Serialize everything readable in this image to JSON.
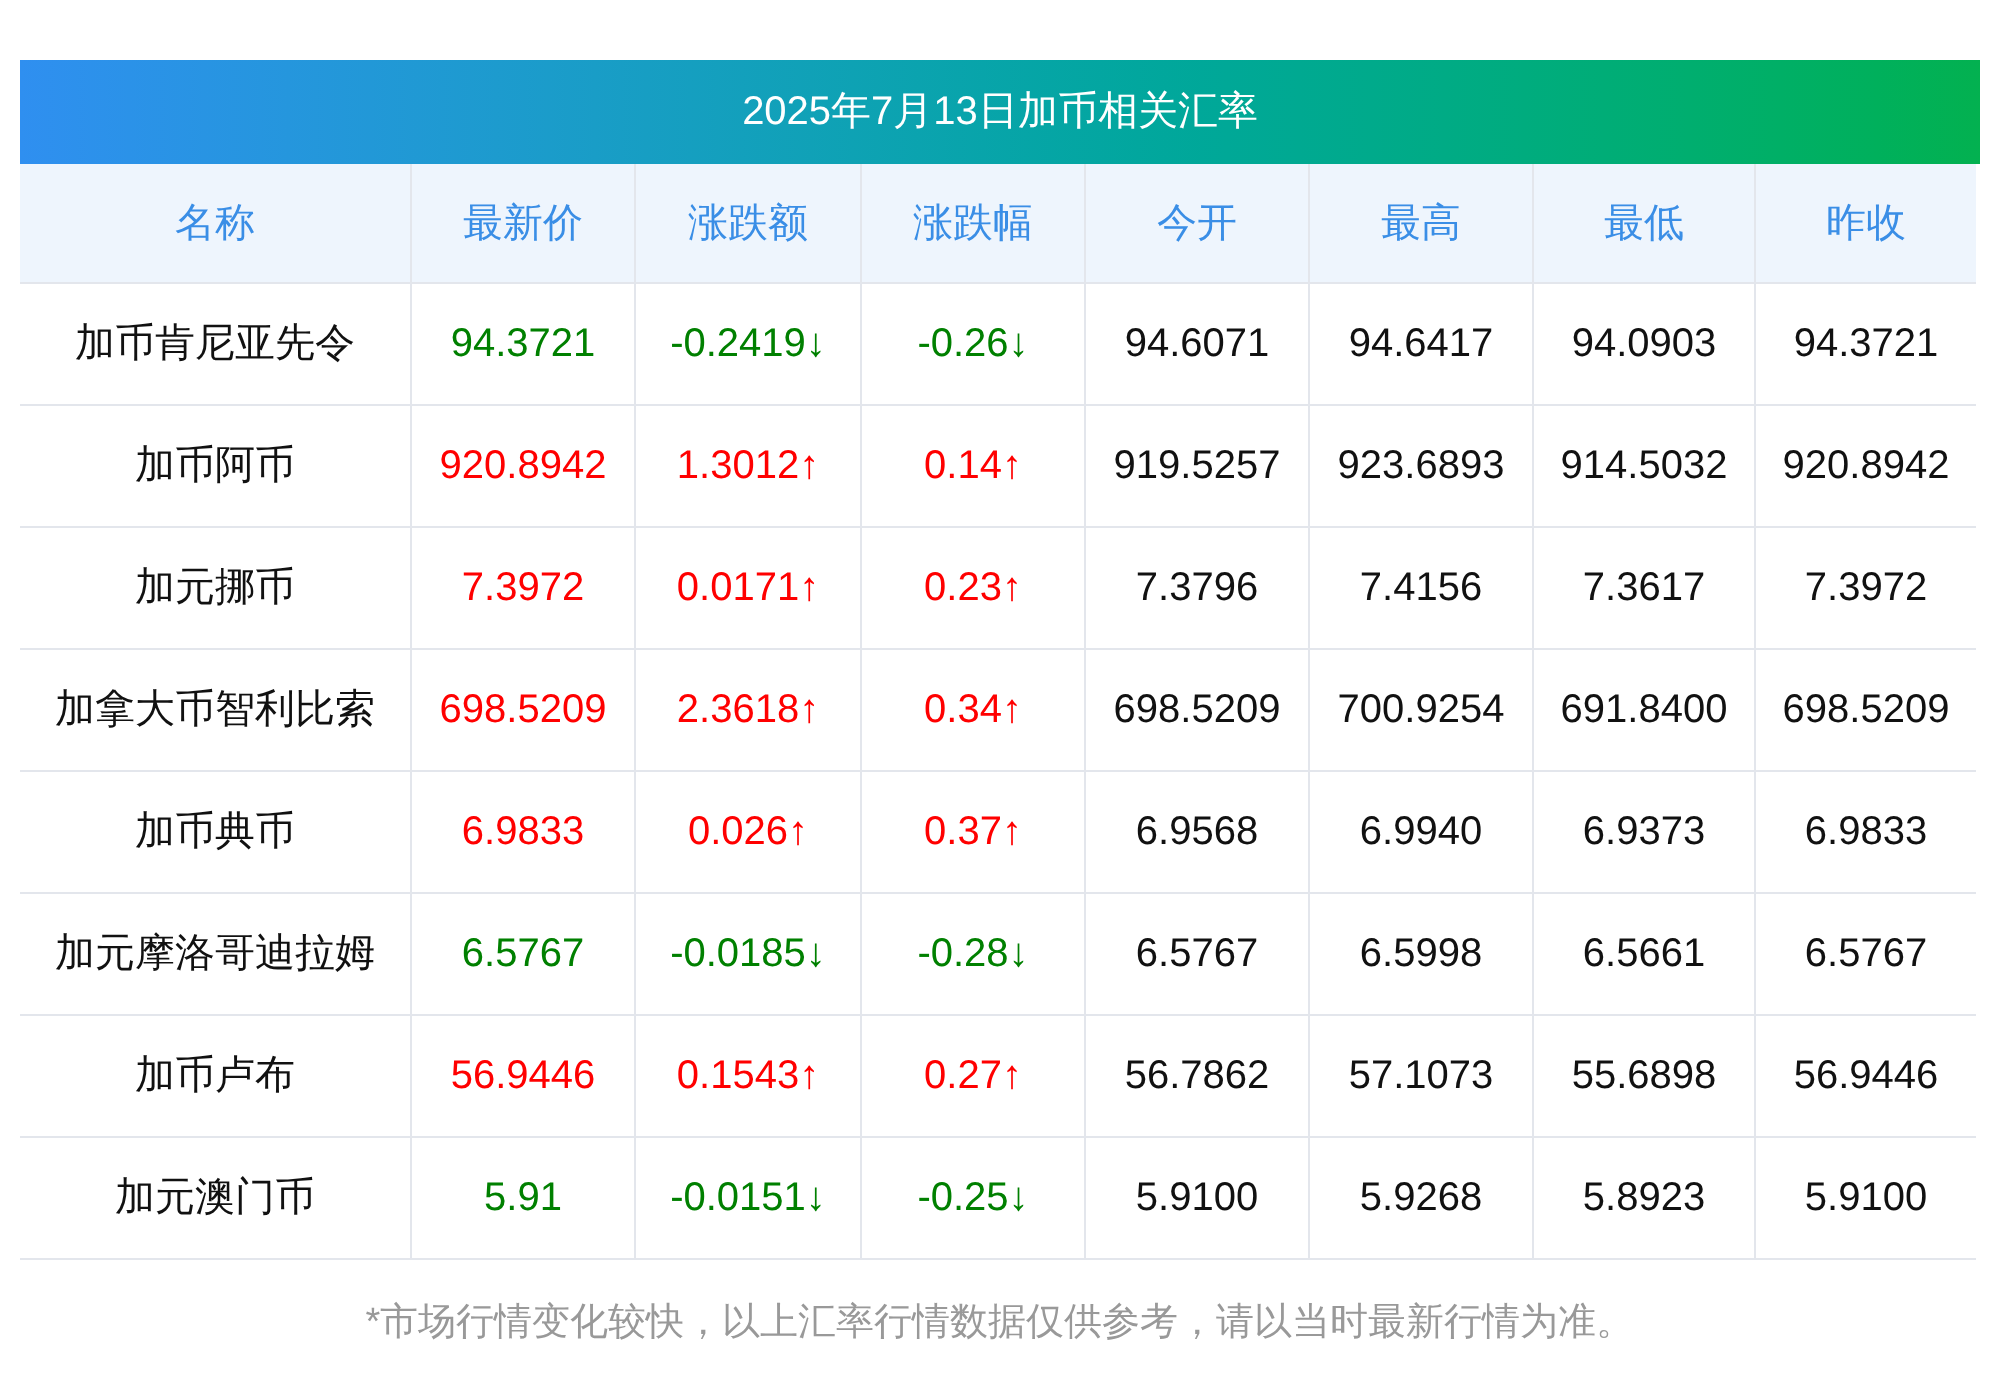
{
  "title": "2025年7月13日加币相关汇率",
  "columns": [
    "名称",
    "最新价",
    "涨跌额",
    "涨跌幅",
    "今开",
    "最高",
    "最低",
    "昨收"
  ],
  "rows": [
    {
      "name": "加币肯尼亚先令",
      "color": "#008000",
      "price": "94.3721",
      "change": "-0.2419↓",
      "pct": "-0.26↓",
      "open": "94.6071",
      "high": "94.6417",
      "low": "94.0903",
      "prev": "94.3721"
    },
    {
      "name": "加币阿币",
      "color": "#ff0000",
      "price": "920.8942",
      "change": "1.3012↑",
      "pct": "0.14↑",
      "open": "919.5257",
      "high": "923.6893",
      "low": "914.5032",
      "prev": "920.8942"
    },
    {
      "name": "加元挪币",
      "color": "#ff0000",
      "price": "7.3972",
      "change": "0.0171↑",
      "pct": "0.23↑",
      "open": "7.3796",
      "high": "7.4156",
      "low": "7.3617",
      "prev": "7.3972"
    },
    {
      "name": "加拿大币智利比索",
      "color": "#ff0000",
      "price": "698.5209",
      "change": "2.3618↑",
      "pct": "0.34↑",
      "open": "698.5209",
      "high": "700.9254",
      "low": "691.8400",
      "prev": "698.5209"
    },
    {
      "name": "加币典币",
      "color": "#ff0000",
      "price": "6.9833",
      "change": "0.026↑",
      "pct": "0.37↑",
      "open": "6.9568",
      "high": "6.9940",
      "low": "6.9373",
      "prev": "6.9833"
    },
    {
      "name": "加元摩洛哥迪拉姆",
      "color": "#008000",
      "price": "6.5767",
      "change": "-0.0185↓",
      "pct": "-0.28↓",
      "open": "6.5767",
      "high": "6.5998",
      "low": "6.5661",
      "prev": "6.5767"
    },
    {
      "name": "加币卢布",
      "color": "#ff0000",
      "price": "56.9446",
      "change": "0.1543↑",
      "pct": "0.27↑",
      "open": "56.7862",
      "high": "57.1073",
      "low": "55.6898",
      "prev": "56.9446"
    },
    {
      "name": "加元澳门币",
      "color": "#008000",
      "price": "5.91",
      "change": "-0.0151↓",
      "pct": "-0.25↓",
      "open": "5.9100",
      "high": "5.9268",
      "low": "5.8923",
      "prev": "5.9100"
    }
  ],
  "footnote": "*市场行情变化较快，以上汇率行情数据仅供参考，请以当时最新行情为准。"
}
